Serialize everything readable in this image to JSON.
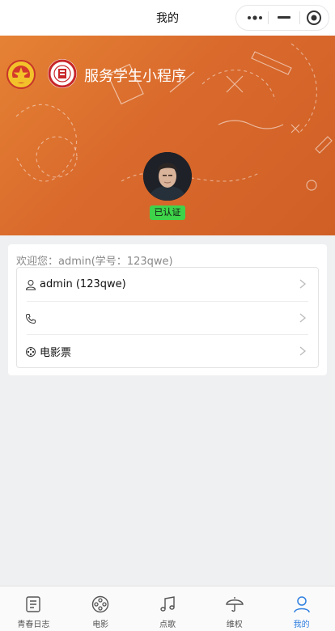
{
  "nav": {
    "title": "我的"
  },
  "banner": {
    "app_name": "服务学生小程序",
    "verified_label": "已认证"
  },
  "profile": {
    "welcome": "欢迎您：admin(学号：123qwe)",
    "rows": [
      {
        "icon": "user-icon",
        "label": "admin (123qwe)"
      },
      {
        "icon": "phone-icon",
        "label": ""
      },
      {
        "icon": "film-icon",
        "label": "电影票"
      }
    ]
  },
  "tabs": [
    {
      "icon": "diary-icon",
      "label": "青春日志",
      "active": false
    },
    {
      "icon": "film-reel-icon",
      "label": "电影",
      "active": false
    },
    {
      "icon": "music-note-icon",
      "label": "点歌",
      "active": false
    },
    {
      "icon": "umbrella-icon",
      "label": "维权",
      "active": false
    },
    {
      "icon": "person-icon",
      "label": "我的",
      "active": true
    }
  ],
  "colors": {
    "banner": "#d9692c",
    "accent": "#2f7fe0",
    "verified": "#3fd34a"
  }
}
